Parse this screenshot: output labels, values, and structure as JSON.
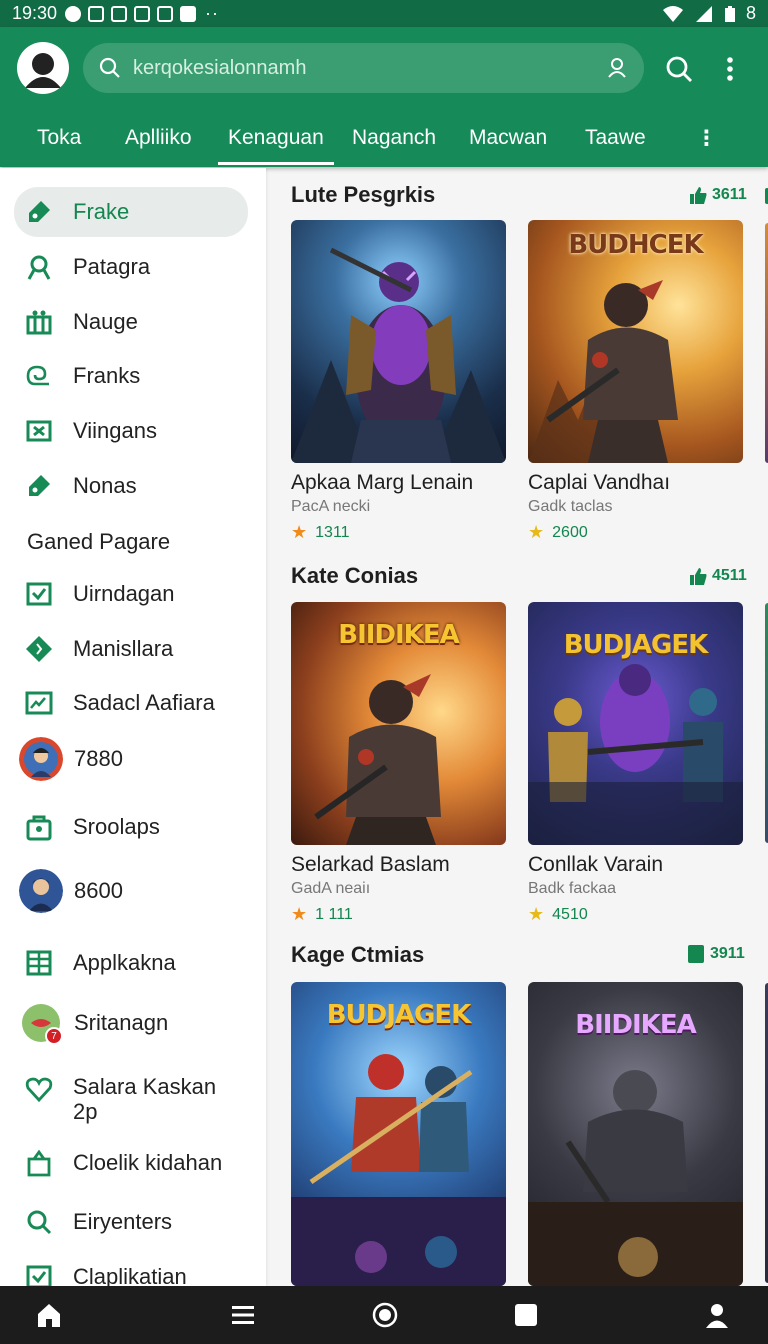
{
  "status": {
    "time": "19:30",
    "battery": "8"
  },
  "search": {
    "placeholder": "kerqokesialonnamh"
  },
  "tabs": [
    {
      "label": "Toka"
    },
    {
      "label": "Aplliiko"
    },
    {
      "label": "Kenaguan"
    },
    {
      "label": "Naganch"
    },
    {
      "label": "Macwan"
    },
    {
      "label": "Taawe"
    }
  ],
  "sidebar": {
    "items": [
      {
        "label": "Frake",
        "icon": "tag-icon"
      },
      {
        "label": "Patagra",
        "icon": "person-icon"
      },
      {
        "label": "Nauge",
        "icon": "gift-icon"
      },
      {
        "label": "Franks",
        "icon": "swirl-icon"
      },
      {
        "label": "Viingans",
        "icon": "box-x-icon"
      },
      {
        "label": "Nonas",
        "icon": "tag-icon"
      },
      {
        "label": "Uirndagan",
        "icon": "check-box-icon"
      },
      {
        "label": "Manisllara",
        "icon": "diamond-icon"
      },
      {
        "label": "Sadacl Aafiara",
        "icon": "image-box-icon"
      },
      {
        "label": "7880",
        "icon": "avatar"
      },
      {
        "label": "Sroolaps",
        "icon": "bag-icon"
      },
      {
        "label": "8600",
        "icon": "avatar"
      },
      {
        "label": "Applkakna",
        "icon": "grid-icon"
      },
      {
        "label": "Sritanagn",
        "icon": "avatar",
        "badge": "7"
      },
      {
        "label": "Salara Kaskan 2p",
        "icon": "heart-icon"
      },
      {
        "label": "Cloelik kidahan",
        "icon": "shopping-bag-icon"
      },
      {
        "label": "Eiryenters",
        "icon": "search-icon"
      },
      {
        "label": "Claplikatian",
        "icon": "check-box-icon"
      }
    ],
    "section_label": "Ganed Pagare"
  },
  "sections": [
    {
      "title": "Lute Pesgrkis",
      "badge": "3611",
      "cards": [
        {
          "name": "Apkaa Marg Lenain",
          "sub": "PacA necki",
          "rating": "1311",
          "art_title": ""
        },
        {
          "name": "Caplai Vandhaı",
          "sub": "Gadk taclas",
          "rating": "2600",
          "art_title": "BUDHCEK"
        }
      ]
    },
    {
      "title": "Kate Conias",
      "badge": "4511",
      "cards": [
        {
          "name": "Selarkad Baslam",
          "sub": "GadA neaiı",
          "rating": "1 111",
          "art_title": "BIIDIKEA"
        },
        {
          "name": "Conllak Varain",
          "sub": "Badk fackaa",
          "rating": "4510",
          "art_title": "BUDJAGEK"
        }
      ]
    },
    {
      "title": "Kage Ctmias",
      "badge": "3911",
      "cards": [
        {
          "name": "",
          "sub": "",
          "rating": "",
          "art_title": "BUDJAGEK"
        },
        {
          "name": "",
          "sub": "",
          "rating": "",
          "art_title": "BIIDIKEA"
        }
      ]
    }
  ],
  "colors": {
    "primary": "#168a58",
    "accent": "#14864f",
    "star_orange": "#f08a1c",
    "star_yellow": "#e8b91a"
  }
}
